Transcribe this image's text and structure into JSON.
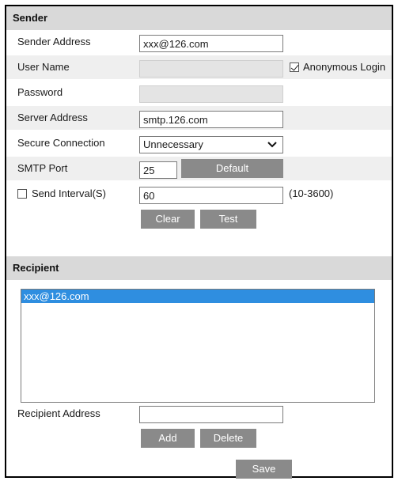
{
  "sender": {
    "header": "Sender",
    "sender_address": {
      "label": "Sender Address",
      "value": "xxx@126.com"
    },
    "user_name": {
      "label": "User Name",
      "value": ""
    },
    "anonymous_login": {
      "label": "Anonymous Login",
      "checked": true
    },
    "password": {
      "label": "Password",
      "value": ""
    },
    "server_address": {
      "label": "Server Address",
      "value": "smtp.126.com"
    },
    "secure_connection": {
      "label": "Secure Connection",
      "selected": "Unnecessary"
    },
    "smtp_port": {
      "label": "SMTP Port",
      "value": "25",
      "default_button": "Default"
    },
    "send_interval": {
      "label": "Send Interval(S)",
      "checked": false,
      "value": "60",
      "range": "(10-3600)"
    },
    "clear_button": "Clear",
    "test_button": "Test"
  },
  "recipient": {
    "header": "Recipient",
    "list": [
      "xxx@126.com"
    ],
    "recipient_address": {
      "label": "Recipient Address",
      "value": ""
    },
    "add_button": "Add",
    "delete_button": "Delete"
  },
  "save_button": "Save",
  "colors": {
    "header_bg": "#d9d9d9",
    "row_shaded": "#efefef",
    "button_bg": "#8a8a8a",
    "selection": "#2f8ee0"
  }
}
